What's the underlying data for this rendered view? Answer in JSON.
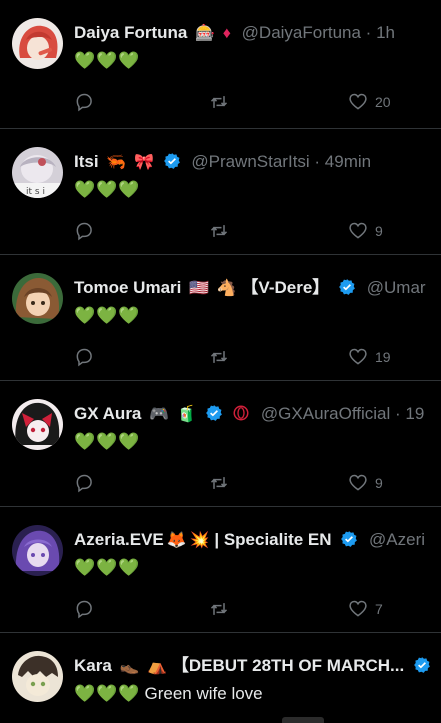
{
  "tweets": [
    {
      "name": "Daiya Fortuna",
      "emojis": [
        "🎰",
        "♦"
      ],
      "verified": false,
      "handle": "@DaiyaFortuna · 1h",
      "hearts": "💚💚💚",
      "text": "",
      "likes": "20",
      "avatar_color": "#e8e2de",
      "accent": "#d84b3f"
    },
    {
      "name": "Itsi",
      "emojis": [
        "🦐",
        "🎀"
      ],
      "verified": true,
      "handle": "@PrawnStarItsi · 49min",
      "hearts": "💚💚💚",
      "text": "",
      "likes": "9",
      "avatar_color": "#c7c3cf",
      "accent": "#b86a74"
    },
    {
      "name": "Tomoe Umari",
      "emojis": [
        "🇺🇸",
        "🐴"
      ],
      "suffix": "【V-Dere】",
      "verified": true,
      "handle": "@Umar",
      "hearts": "💚💚💚",
      "text": "",
      "likes": "19",
      "avatar_color": "#d9a06a",
      "accent": "#7a4a2a"
    },
    {
      "name": "GX Aura",
      "emojis": [
        "🎮",
        "🧃"
      ],
      "verified": true,
      "extra_badge": "⭕",
      "handle": "@GXAuraOfficial · 19",
      "hearts": "💚💚💚",
      "text": "",
      "likes": "9",
      "avatar_color": "#f0e8ea",
      "accent": "#c0203a"
    },
    {
      "name": "Azeria.EVE",
      "emojis": [
        "🦊",
        "💥"
      ],
      "suffix": "| Specialite EN",
      "verified": true,
      "handle": "@Azeri",
      "hearts": "💚💚💚",
      "text": "",
      "likes": "7",
      "avatar_color": "#5a4a8a",
      "accent": "#d8c8ff"
    },
    {
      "name": "Kara",
      "emojis": [
        "👞",
        "⛺"
      ],
      "suffix": "【DEBUT 28TH OF MARCH...",
      "verified": true,
      "handle": "",
      "hearts": "💚💚💚",
      "text": "Green wife love",
      "likes": "",
      "avatar_color": "#e9e0d2",
      "accent": "#3c3028"
    }
  ],
  "icons": {
    "reply": "reply-icon",
    "retweet": "retweet-icon",
    "like": "heart-icon",
    "verified": "verified-badge-icon"
  },
  "colors": {
    "background": "#000000",
    "text": "#e7e9ea",
    "muted": "#71767b",
    "verified": "#1d9bf0",
    "divider": "#2f3336"
  }
}
